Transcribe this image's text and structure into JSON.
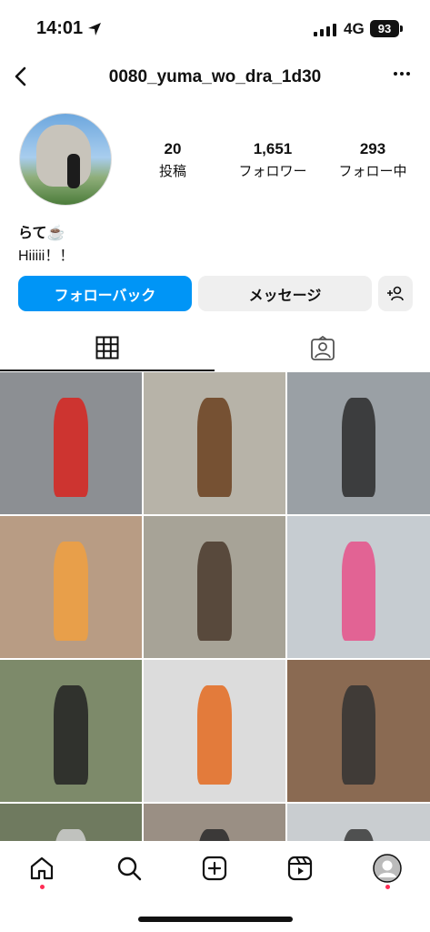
{
  "status_bar": {
    "time": "14:01",
    "network": "4G",
    "battery": "93"
  },
  "header": {
    "username": "0080_yuma_wo_dra_1d30"
  },
  "profile": {
    "stats": [
      {
        "value": "20",
        "label": "投稿"
      },
      {
        "value": "1,651",
        "label": "フォロワー"
      },
      {
        "value": "293",
        "label": "フォロー中"
      }
    ],
    "bio_name": "らて☕️",
    "bio_text": "Hiiiii！！"
  },
  "actions": {
    "follow_back": "フォローバック",
    "message": "メッセージ"
  },
  "tabs": [
    {
      "icon": "grid-icon",
      "active": true
    },
    {
      "icon": "tagged-person-icon",
      "active": false
    }
  ],
  "posts": [
    {
      "bg": "#8c8f93",
      "accent": "#d8251f"
    },
    {
      "bg": "#b7b3a8",
      "accent": "#6b3f1e"
    },
    {
      "bg": "#9aa0a5",
      "accent": "#2c2c2c"
    },
    {
      "bg": "#b89c84",
      "accent": "#f0a040"
    },
    {
      "bg": "#a7a397",
      "accent": "#4a3a2c"
    },
    {
      "bg": "#c6ccd1",
      "accent": "#e6508a"
    },
    {
      "bg": "#7d8a6a",
      "accent": "#222222"
    },
    {
      "bg": "#dcdcdc",
      "accent": "#e46a1e"
    },
    {
      "bg": "#8a6a52",
      "accent": "#333333"
    },
    {
      "bg": "#6f7a5f",
      "accent": "#cfcfcf"
    },
    {
      "bg": "#9a8f84",
      "accent": "#2a2a2a"
    },
    {
      "bg": "#c9cdd0",
      "accent": "#3a3a3a"
    }
  ],
  "bottom_nav": [
    "home-icon",
    "search-icon",
    "create-icon",
    "reels-icon",
    "profile-icon"
  ],
  "colors": {
    "accent": "#0095f6",
    "notification": "#ff2d55"
  }
}
